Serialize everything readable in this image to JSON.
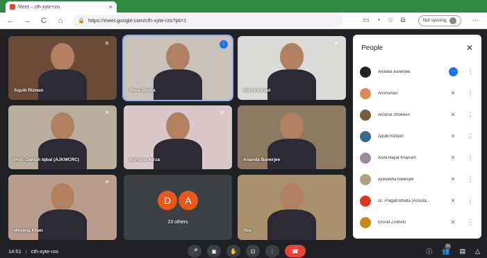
{
  "browser": {
    "tab_title": "Meet – cth-xyte-rzo",
    "url": "https://meet.google.com/cth-xyte-rzo?pli=1",
    "sync_label": "Not syncing",
    "nav": {
      "back": "←",
      "forward": "→",
      "reload": "C",
      "home": "⌂"
    }
  },
  "tiles": [
    {
      "name": "Aquib Rizwan",
      "muted": true,
      "bg": "#6b4a3a"
    },
    {
      "name": "Rhea Bhatia",
      "muted": false,
      "speaking": true,
      "bg": "#c9c2bb"
    },
    {
      "name": "Hafifa Irshad",
      "muted": true,
      "bg": "#dcdad6"
    },
    {
      "name": "Prof. Danish Iqbal (AJKMCRC)",
      "muted": true,
      "bg": "#b9ad9d"
    },
    {
      "name": "Rumsha Mirza",
      "muted": true,
      "bg": "#d9c7c9"
    },
    {
      "name": "Ananda Banerjee",
      "muted": false,
      "bg": "#8d7a62"
    },
    {
      "name": "Mesena Khan",
      "muted": true,
      "bg": "#b89c8c"
    },
    {
      "name": "You",
      "muted": false,
      "bg": "#a9916c"
    }
  ],
  "others": {
    "initials": [
      "D",
      "A"
    ],
    "label": "23 others"
  },
  "people_panel": {
    "title": "People",
    "participants": [
      {
        "name": "Ananda Banerjee",
        "color": "#222222",
        "speaking": true
      },
      {
        "name": "Anshuman",
        "color": "#d98b5a"
      },
      {
        "name": "Anuvrat Shokeen",
        "color": "#7a5a3a"
      },
      {
        "name": "Aquib Rizwan",
        "color": "#3b6a8a"
      },
      {
        "name": "Asifa Hayat Khanam",
        "color": "#9a8a9a"
      },
      {
        "name": "ayanabha banerjee",
        "color": "#b0a080"
      },
      {
        "name": "Dr. Pragati Bhalla (Assista...",
        "color": "#d9381e"
      },
      {
        "name": "ERAM ZAMAN",
        "color": "#c9881e"
      }
    ]
  },
  "bottom": {
    "time": "14:51",
    "meeting_code": "cth-xyte-rzo",
    "people_count": "31"
  }
}
